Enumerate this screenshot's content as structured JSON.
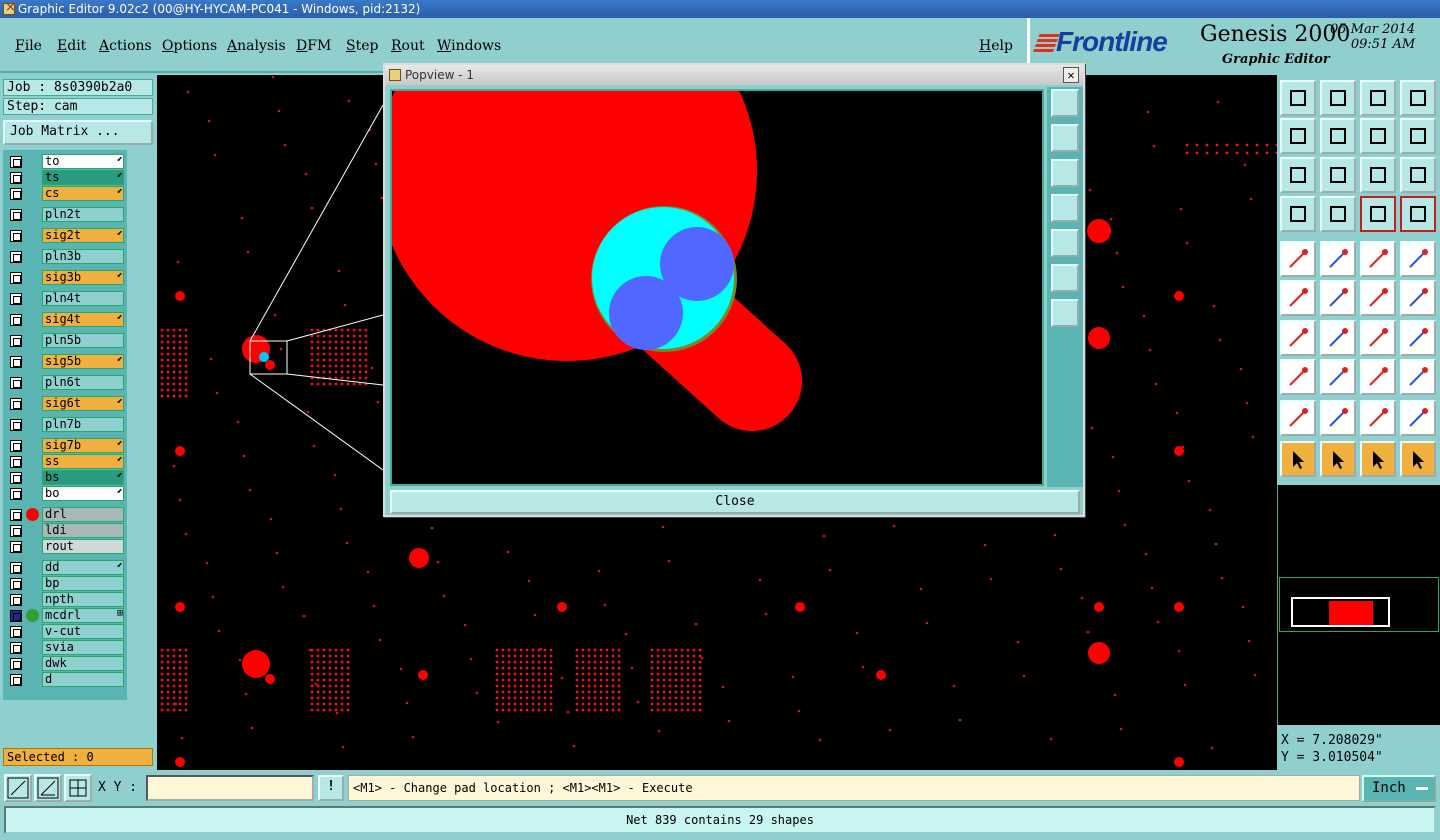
{
  "window": {
    "title": "Graphic Editor 9.02c2 (00@HY-HYCAM-PC041 - Windows, pid:2132)"
  },
  "menu": {
    "items": [
      "File",
      "Edit",
      "Actions",
      "Options",
      "Analysis",
      "DFM",
      "Step",
      "Rout",
      "Windows"
    ],
    "help": "Help"
  },
  "brand": {
    "logo": "Frontline",
    "product": "Genesis 2000",
    "date": "05 Mar 2014",
    "time": "09:51 AM",
    "subtitle": "Graphic Editor"
  },
  "job": {
    "job_label": "Job : 8s0390b2a0",
    "step_label": "Step: cam",
    "matrix_button": "Job Matrix ..."
  },
  "layers": [
    {
      "name": "to",
      "color": "#ffffff",
      "mark": "⬋"
    },
    {
      "name": "ts",
      "color": "#2a9a80",
      "mark": "⬋"
    },
    {
      "name": "cs",
      "color": "#f0b040",
      "mark": "⬋"
    },
    {
      "name": "pln2t",
      "color": "#8fd0cf",
      "mark": ""
    },
    {
      "name": "sig2t",
      "color": "#f0b040",
      "mark": "⬋"
    },
    {
      "name": "pln3b",
      "color": "#8fd0cf",
      "mark": ""
    },
    {
      "name": "sig3b",
      "color": "#f0b040",
      "mark": "⬋"
    },
    {
      "name": "pln4t",
      "color": "#8fd0cf",
      "mark": ""
    },
    {
      "name": "sig4t",
      "color": "#f0b040",
      "mark": "⬋"
    },
    {
      "name": "pln5b",
      "color": "#8fd0cf",
      "mark": ""
    },
    {
      "name": "sig5b",
      "color": "#f0b040",
      "mark": "⬋"
    },
    {
      "name": "pln6t",
      "color": "#8fd0cf",
      "mark": ""
    },
    {
      "name": "sig6t",
      "color": "#f0b040",
      "mark": "⬋"
    },
    {
      "name": "pln7b",
      "color": "#8fd0cf",
      "mark": ""
    },
    {
      "name": "sig7b",
      "color": "#f0b040",
      "mark": "⬋"
    },
    {
      "name": "ss",
      "color": "#f0b040",
      "mark": "⬋"
    },
    {
      "name": "bs",
      "color": "#2a9a80",
      "mark": "⬋"
    },
    {
      "name": "bo",
      "color": "#ffffff",
      "mark": "⬋"
    },
    {
      "name": "drl",
      "color": "#a8b8b8",
      "mark": ""
    },
    {
      "name": "ldi",
      "color": "#a8b8b8",
      "mark": ""
    },
    {
      "name": "rout",
      "color": "#d0d8d8",
      "mark": ""
    },
    {
      "name": "dd",
      "color": "#8fd0cf",
      "mark": "⬋"
    },
    {
      "name": "bp",
      "color": "#8fd0cf",
      "mark": ""
    },
    {
      "name": "npth",
      "color": "#8fd0cf",
      "mark": ""
    },
    {
      "name": "mcdrl",
      "color": "#8fd0cf",
      "mark": "⊞"
    },
    {
      "name": "v-cut",
      "color": "#8fd0cf",
      "mark": ""
    },
    {
      "name": "svia",
      "color": "#8fd0cf",
      "mark": ""
    },
    {
      "name": "dwk",
      "color": "#8fd0cf",
      "mark": ""
    },
    {
      "name": "d",
      "color": "#8fd0cf",
      "mark": ""
    }
  ],
  "selected": "Selected : 0",
  "popview": {
    "title": "Popview - 1",
    "close_label": "Close"
  },
  "coords": {
    "x": "X = 7.208029\"",
    "y": "Y = 3.010504\""
  },
  "bottom": {
    "xy_label": "X Y :",
    "xy_value": "",
    "prompt_button": "!",
    "prompt": "<M1> - Change pad location ; <M1><M1> - Execute",
    "unit": "Inch"
  },
  "status": "Net 839 contains 29 shapes",
  "colors": {
    "accent": "#8fd0cf",
    "feature": "#ff0000",
    "highlight": "#00ffff",
    "selected_pad": "#5068ff"
  }
}
